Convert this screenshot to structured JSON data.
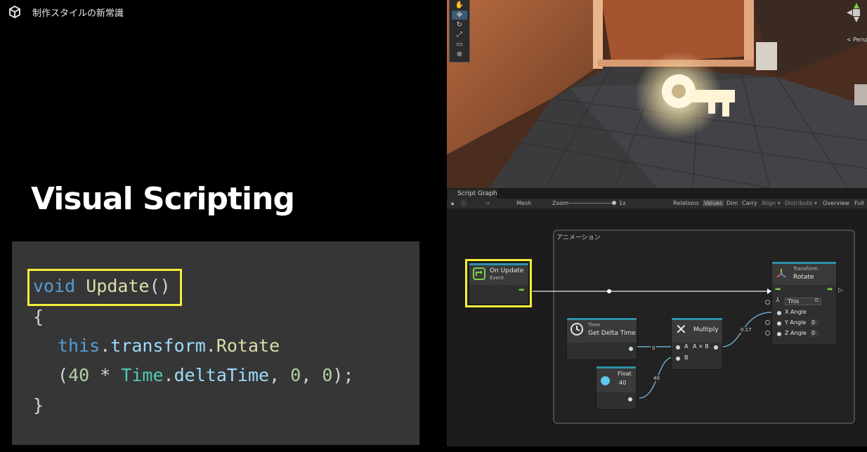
{
  "header": {
    "title": "制作スタイルの新常識"
  },
  "slide": {
    "title": "Visual Scripting"
  },
  "code": {
    "line1_keyword": "void",
    "line1_method": "Update",
    "line1_parens": "()",
    "line2": "{",
    "line3_this": "this",
    "line3_dot1": ".",
    "line3_prop": "transform",
    "line3_dot2": ".",
    "line3_method": "Rotate",
    "line4_open": "(",
    "line4_num1": "40",
    "line4_op": " * ",
    "line4_class": "Time",
    "line4_dot": ".",
    "line4_prop": "deltaTime",
    "line4_sep1": ", ",
    "line4_num2": "0",
    "line4_sep2": ", ",
    "line4_num3": "0",
    "line4_close": ");",
    "line5": "}"
  },
  "scene": {
    "toolbar_icons": [
      "hand-icon",
      "move-icon",
      "rotate-icon",
      "scale-icon",
      "rect-icon",
      "transform-icon"
    ],
    "persp_label": "< Persp"
  },
  "graph": {
    "tab_label": "Script Graph",
    "toolbar": {
      "mesh": "Mesh",
      "zoom": "Zoom",
      "zoom_value": "1x",
      "relations": "Relations",
      "values": "Values",
      "dim": "Dim",
      "carry": "Carry",
      "align": "Align ▾",
      "distribute": "Distribute ▾",
      "overview": "Overview",
      "full": "Full"
    },
    "group_title": "アニメーション",
    "nodes": {
      "on_update": {
        "title": "On Update",
        "subtitle": "Event"
      },
      "transform_rotate": {
        "title": "Transform",
        "subtitle": "Rotate",
        "target": "This",
        "x_angle": "X Angle",
        "y_angle": "Y Angle",
        "y_value": "0",
        "z_angle": "Z Angle",
        "z_value": "0"
      },
      "get_delta_time": {
        "title": "Time",
        "subtitle": "Get Delta Time"
      },
      "multiply": {
        "title": "Multiply",
        "port_a": "A",
        "formula": "A × B",
        "port_b": "B"
      },
      "float": {
        "title": "Float",
        "value": "40"
      }
    },
    "wire_labels": {
      "delta_value": "0",
      "float_value": "40",
      "product_value": "0.17"
    }
  },
  "colors": {
    "highlight": "#f2ef3a",
    "keyword": "#569cd6",
    "method": "#dcdcaa",
    "class": "#4ec9b0",
    "property": "#9cdcfe",
    "number": "#b5cea8",
    "node_accent": "#2e93a8",
    "flow_arrow": "#7ecf4a"
  }
}
